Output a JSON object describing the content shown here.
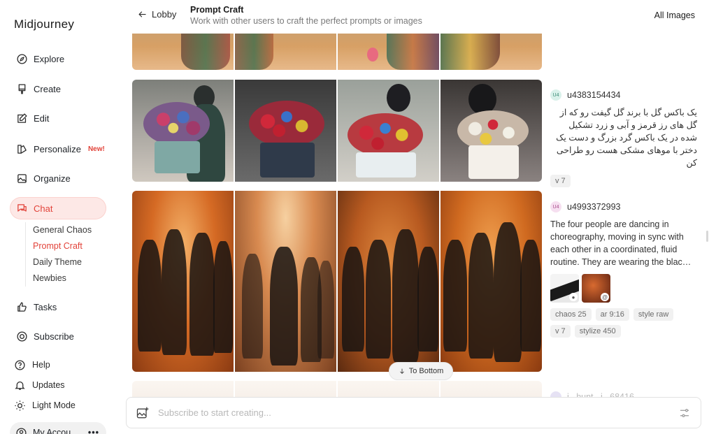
{
  "app": {
    "brand": "Midjourney"
  },
  "sidebar": {
    "items": [
      {
        "label": "Explore",
        "icon": "compass-icon"
      },
      {
        "label": "Create",
        "icon": "brush-icon"
      },
      {
        "label": "Edit",
        "icon": "edit-icon"
      },
      {
        "label": "Personalize",
        "icon": "palette-icon",
        "badge": "New!"
      },
      {
        "label": "Organize",
        "icon": "image-icon"
      },
      {
        "label": "Chat",
        "icon": "chat-icon",
        "active": true
      },
      {
        "label": "Tasks",
        "icon": "thumbs-up-icon"
      },
      {
        "label": "Subscribe",
        "icon": "subscribe-icon"
      }
    ],
    "chat_channels": [
      {
        "label": "General Chaos"
      },
      {
        "label": "Prompt Craft",
        "active": true
      },
      {
        "label": "Daily Theme"
      },
      {
        "label": "Newbies"
      }
    ],
    "footer": [
      {
        "label": "Help",
        "icon": "help-icon"
      },
      {
        "label": "Updates",
        "icon": "bell-icon"
      },
      {
        "label": "Light Mode",
        "icon": "sun-icon"
      }
    ],
    "account": {
      "label": "My Accou",
      "more": "•••"
    }
  },
  "header": {
    "back_label": "Lobby",
    "channel_title": "Prompt Craft",
    "channel_desc": "Work with other users to craft the perfect prompts or images",
    "all_images": "All Images"
  },
  "posts": [
    {
      "user": "u4383154434",
      "avatar": "U4",
      "avatar_color": "#d9f1ea",
      "prompt": "یک باکس گل با برند گل گیفت رو که از گل های رز قرمز و آبی و زرد تشکیل شده در یک باکس گرد بزرگ و دست یک دختر با موهای مشکی هست رو طراحی کن",
      "chips": [
        "v 7"
      ]
    },
    {
      "user": "u4993372993",
      "avatar": "U4",
      "avatar_color": "#f6dff0",
      "prompt": "The four people are dancing in choreography, moving in sync with each other in a coordinated, fluid routine. They are wearing the blac…",
      "chips": [
        "chaos 25",
        "ar 9:16",
        "style raw",
        "v 7",
        "stylize 450"
      ]
    },
    {
      "user": "j...hunt...i...68416"
    }
  ],
  "to_bottom": "To Bottom",
  "composer": {
    "placeholder": "Subscribe to start creating..."
  },
  "colors": {
    "accent": "#e2433a",
    "active_bg": "#fde8e6"
  }
}
